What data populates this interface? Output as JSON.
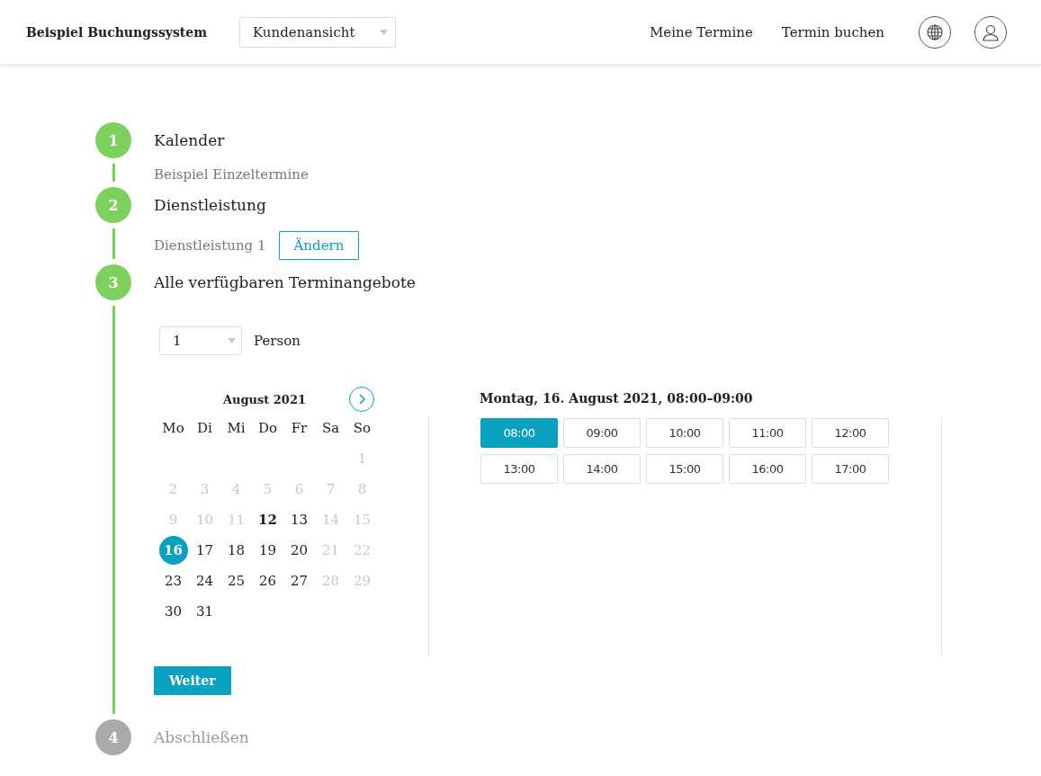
{
  "header": {
    "brand": "Beispiel Buchungssystem",
    "view_select": {
      "value": "Kundenansicht"
    },
    "nav": [
      {
        "label": "Meine Termine"
      },
      {
        "label": "Termin buchen"
      }
    ]
  },
  "steps": [
    {
      "number": "1",
      "title": "Kalender",
      "completed": true,
      "summary": "Beispiel Einzeltermine"
    },
    {
      "number": "2",
      "title": "Dienstleistung",
      "completed": true,
      "summary": "Dienstleistung 1",
      "change_button": "Ändern"
    },
    {
      "number": "3",
      "title": "Alle verfügbaren Terminangebote",
      "completed": true,
      "expanded": true
    },
    {
      "number": "4",
      "title": "Abschließen",
      "completed": false
    }
  ],
  "booking": {
    "persons_select": {
      "value": "1"
    },
    "persons_label": "Person",
    "calendar": {
      "month": "August 2021",
      "weekdays": [
        "Mo",
        "Di",
        "Mi",
        "Do",
        "Fr",
        "Sa",
        "So"
      ],
      "weeks": [
        {
          "days": [
            {
              "day": "1",
              "disabled": true,
              "selected": false,
              "today": false
            }
          ]
        },
        {
          "days": [
            {
              "day": "2",
              "disabled": true,
              "selected": false,
              "today": false
            },
            {
              "day": "3",
              "disabled": true,
              "selected": false,
              "today": false
            },
            {
              "day": "4",
              "disabled": true,
              "selected": false,
              "today": false
            },
            {
              "day": "5",
              "disabled": true,
              "selected": false,
              "today": false
            },
            {
              "day": "6",
              "disabled": true,
              "selected": false,
              "today": false
            },
            {
              "day": "7",
              "disabled": true,
              "selected": false,
              "today": false
            },
            {
              "day": "8",
              "disabled": true,
              "selected": false,
              "today": false
            }
          ]
        },
        {
          "days": [
            {
              "day": "9",
              "disabled": true,
              "selected": false,
              "today": false
            },
            {
              "day": "10",
              "disabled": true,
              "selected": false,
              "today": false
            },
            {
              "day": "11",
              "disabled": true,
              "selected": false,
              "today": false
            },
            {
              "day": "12",
              "disabled": false,
              "selected": false,
              "today": true
            },
            {
              "day": "13",
              "disabled": false,
              "selected": false,
              "today": false
            },
            {
              "day": "14",
              "disabled": true,
              "selected": false,
              "today": false
            },
            {
              "day": "15",
              "disabled": true,
              "selected": false,
              "today": false
            }
          ]
        },
        {
          "days": [
            {
              "day": "16",
              "disabled": false,
              "selected": true,
              "today": false
            },
            {
              "day": "17",
              "disabled": false,
              "selected": false,
              "today": false
            },
            {
              "day": "18",
              "disabled": false,
              "selected": false,
              "today": false
            },
            {
              "day": "19",
              "disabled": false,
              "selected": false,
              "today": false
            },
            {
              "day": "20",
              "disabled": false,
              "selected": false,
              "today": false
            },
            {
              "day": "21",
              "disabled": true,
              "selected": false,
              "today": false
            },
            {
              "day": "22",
              "disabled": true,
              "selected": false,
              "today": false
            }
          ]
        },
        {
          "days": [
            {
              "day": "23",
              "disabled": false,
              "selected": false,
              "today": false
            },
            {
              "day": "24",
              "disabled": false,
              "selected": false,
              "today": false
            },
            {
              "day": "25",
              "disabled": false,
              "selected": false,
              "today": false
            },
            {
              "day": "26",
              "disabled": false,
              "selected": false,
              "today": false
            },
            {
              "day": "27",
              "disabled": false,
              "selected": false,
              "today": false
            },
            {
              "day": "28",
              "disabled": true,
              "selected": false,
              "today": false
            },
            {
              "day": "29",
              "disabled": true,
              "selected": false,
              "today": false
            }
          ]
        },
        {
          "days": [
            {
              "day": "30",
              "disabled": false,
              "selected": false,
              "today": false
            },
            {
              "day": "31",
              "disabled": false,
              "selected": false,
              "today": false
            }
          ]
        }
      ]
    },
    "selected_slot": "Montag, 16. August 2021, 08:00–09:00",
    "slots": [
      {
        "time": "08:00",
        "selected": true
      },
      {
        "time": "09:00",
        "selected": false
      },
      {
        "time": "10:00",
        "selected": false
      },
      {
        "time": "11:00",
        "selected": false
      },
      {
        "time": "12:00",
        "selected": false
      },
      {
        "time": "13:00",
        "selected": false
      },
      {
        "time": "14:00",
        "selected": false
      },
      {
        "time": "15:00",
        "selected": false
      },
      {
        "time": "16:00",
        "selected": false
      },
      {
        "time": "17:00",
        "selected": false
      }
    ],
    "next_button": "Weiter"
  }
}
